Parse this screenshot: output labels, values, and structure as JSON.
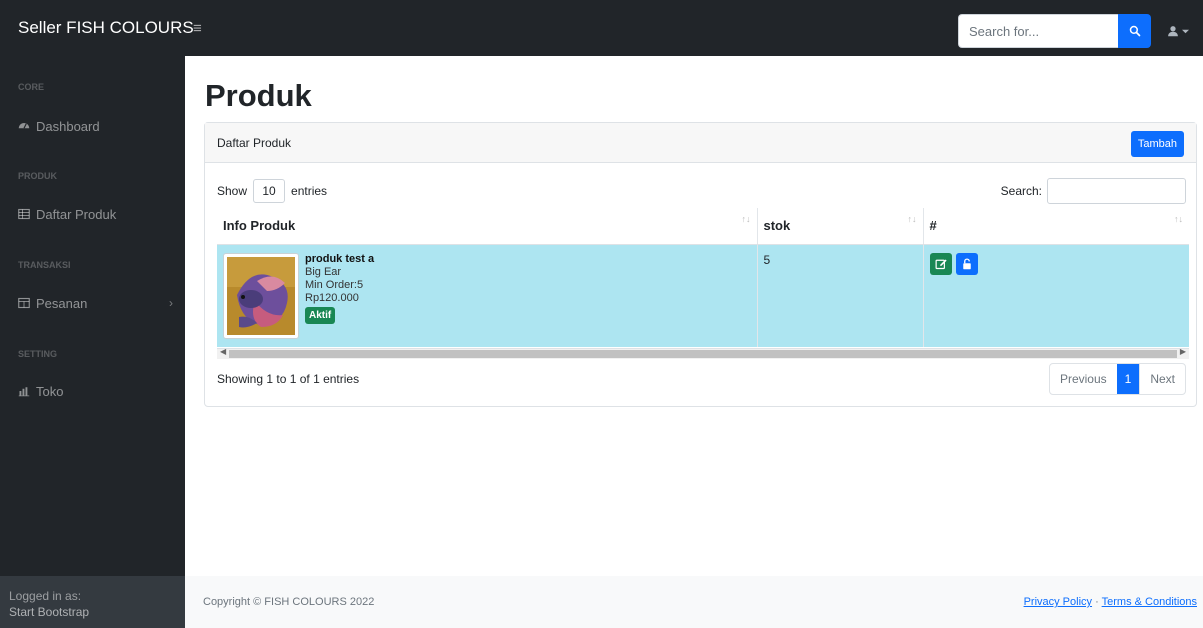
{
  "navbar": {
    "brand": "Seller FISH COLOURS",
    "search_placeholder": "Search for..."
  },
  "sidebar": {
    "headings": {
      "core": "CORE",
      "produk": "PRODUK",
      "transaksi": "TRANSAKSI",
      "setting": "SETTING"
    },
    "items": {
      "dashboard": "Dashboard",
      "daftar_produk": "Daftar Produk",
      "pesanan": "Pesanan",
      "toko": "Toko"
    },
    "footer": {
      "label": "Logged in as:",
      "user": "Start Bootstrap"
    }
  },
  "main": {
    "title": "Produk",
    "card_title": "Daftar Produk",
    "add_button": "Tambah",
    "length": {
      "show": "Show",
      "value": "10",
      "entries": "entries"
    },
    "search_label": "Search:",
    "columns": {
      "info": "Info Produk",
      "stok": "stok",
      "actions": "#"
    },
    "rows": [
      {
        "name": "produk test a",
        "variant": "Big Ear",
        "min_order": "Min Order:5",
        "price": "Rp120.000",
        "status": "Aktif",
        "stok": "5"
      }
    ],
    "info_text": "Showing 1 to 1 of 1 entries",
    "pagination": {
      "previous": "Previous",
      "current": "1",
      "next": "Next"
    }
  },
  "footer": {
    "copyright": "Copyright © FISH COLOURS 2022",
    "privacy": "Privacy Policy",
    "separator": "·",
    "terms": "Terms & Conditions"
  },
  "colors": {
    "primary": "#0d6efd",
    "success": "#198754",
    "sidebar": "#212529",
    "row_highlight": "#ade5f1"
  }
}
